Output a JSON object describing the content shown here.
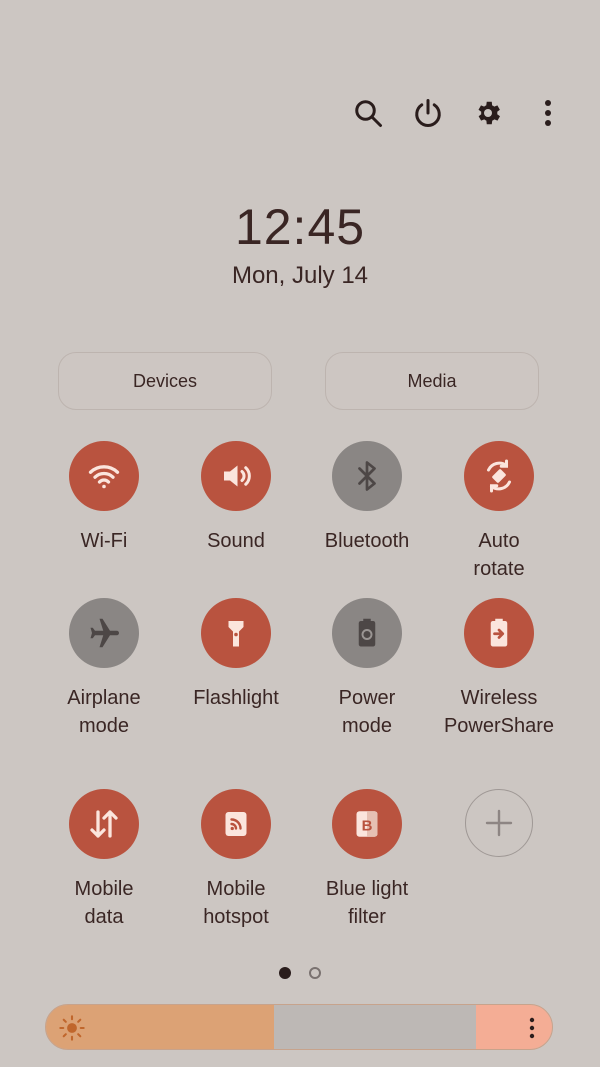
{
  "top_actions": [
    {
      "name": "search-icon"
    },
    {
      "name": "power-icon"
    },
    {
      "name": "settings-icon"
    },
    {
      "name": "more-options-icon"
    }
  ],
  "clock": {
    "time": "12:45",
    "date": "Mon, July 14"
  },
  "quick_buttons": {
    "devices": "Devices",
    "media": "Media"
  },
  "tiles": [
    {
      "label": "Wi-Fi",
      "icon": "wifi-icon",
      "state": "on"
    },
    {
      "label": "Sound",
      "icon": "sound-icon",
      "state": "on"
    },
    {
      "label": "Bluetooth",
      "icon": "bluetooth-icon",
      "state": "off"
    },
    {
      "label": "Auto\nrotate",
      "icon": "auto-rotate-icon",
      "state": "on"
    },
    {
      "label": "Airplane\nmode",
      "icon": "airplane-icon",
      "state": "off"
    },
    {
      "label": "Flashlight",
      "icon": "flashlight-icon",
      "state": "on"
    },
    {
      "label": "Power\nmode",
      "icon": "power-mode-icon",
      "state": "off"
    },
    {
      "label": "Wireless\nPowerShare",
      "icon": "wireless-powershare-icon",
      "state": "on"
    },
    {
      "label": "Mobile\ndata",
      "icon": "mobile-data-icon",
      "state": "on"
    },
    {
      "label": "Mobile\nhotspot",
      "icon": "mobile-hotspot-icon",
      "state": "on"
    },
    {
      "label": "Blue light\nfilter",
      "icon": "blue-light-filter-icon",
      "state": "on"
    },
    {
      "label": "",
      "icon": "add-tile-icon",
      "state": "add"
    }
  ],
  "pager": {
    "pages": 2,
    "current": 1
  },
  "brightness": {
    "level": 0.45,
    "icon": "sun-icon",
    "menu_icon": "more-options-icon"
  },
  "colors": {
    "background": "#ccc6c2",
    "tile_on": "#b9533f",
    "tile_off": "#8a8684",
    "brightness_fill": "#dca275",
    "brightness_end": "#f4ad95",
    "text": "#3a2624"
  }
}
